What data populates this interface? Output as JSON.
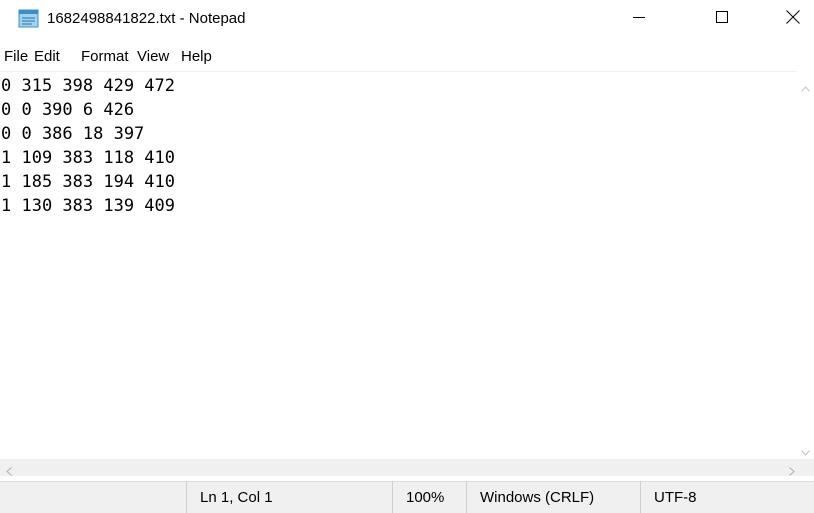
{
  "window": {
    "title": "1682498841822.txt - Notepad",
    "icon": "notepad-icon",
    "controls": {
      "minimize_icon": "minimize-icon",
      "maximize_icon": "maximize-icon",
      "close_icon": "close-icon"
    }
  },
  "menu": {
    "items": [
      "File",
      "Edit",
      "Format",
      "View",
      "Help"
    ]
  },
  "editor": {
    "lines": [
      "0 315 398 429 472",
      "0 0 390 6 426",
      "0 0 386 18 397",
      "1 109 383 118 410",
      "1 185 383 194 410",
      "1 130 383 139 409"
    ]
  },
  "statusbar": {
    "position": "Ln 1, Col 1",
    "zoom": "100%",
    "line_ending": "Windows (CRLF)",
    "encoding": "UTF-8"
  },
  "colors": {
    "chrome": "#ffffff",
    "statusbar_bg": "#f0f0f0",
    "scroll_arrow": "#c2c2c2"
  }
}
